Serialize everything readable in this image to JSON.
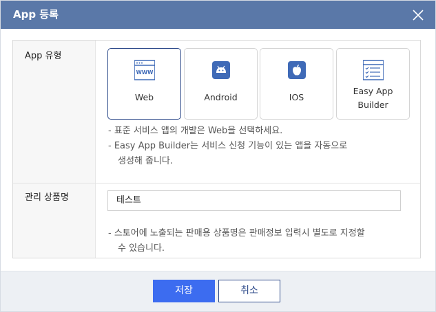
{
  "dialog": {
    "title": "App 등록",
    "close_icon": "close-icon"
  },
  "app_type": {
    "label": "App 유형",
    "options": [
      {
        "label": "Web",
        "icon": "web-browser-icon",
        "selected": true
      },
      {
        "label": "Android",
        "icon": "android-icon",
        "selected": false
      },
      {
        "label": "IOS",
        "icon": "apple-icon",
        "selected": false
      },
      {
        "label_line1": "Easy App",
        "label_line2": "Builder",
        "icon": "checklist-icon",
        "selected": false
      }
    ],
    "notes": {
      "line1": "- 표준 서비스 앱의 개발은 Web을 선택하세요.",
      "line2": "- Easy App Builder는 서비스 신청 기능이 있는 앱을 자동으로",
      "line3": "생성해 줍니다."
    }
  },
  "product_name": {
    "label": "관리 상품명",
    "value": "테스트",
    "notes": {
      "line1": "- 스토어에 노출되는 판매용 상품명은 판매정보 입력시 별도로 지정할",
      "line2": "수 있습니다."
    }
  },
  "footer": {
    "save_label": "저장",
    "cancel_label": "취소"
  },
  "colors": {
    "titlebar": "#5a78a8",
    "primary_button": "#3c6cf0",
    "selected_border": "#2d4a8a",
    "icon_accent": "#3f6ab7",
    "footer_bg": "#edf0f4"
  }
}
